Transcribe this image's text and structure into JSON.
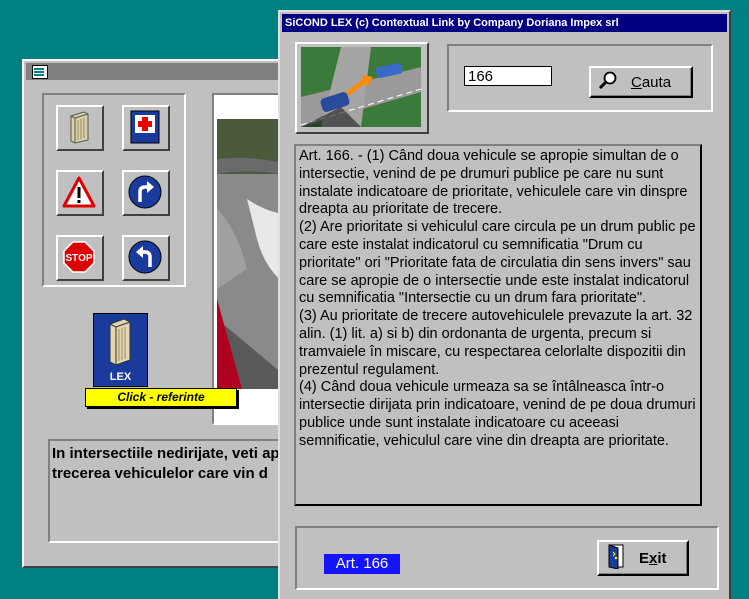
{
  "front_window": {
    "title": "SiCOND LEX (c) Contextual Link by Company Doriana Impex srl",
    "article_input_value": "166",
    "search_button_label": "Cauta",
    "article_text": "Art. 166. - (1) Când doua vehicule se apropie simultan de o intersectie, venind de pe drumuri publice pe care nu sunt instalate indicatoare de prioritate, vehiculele care vin dinspre dreapta au prioritate de trecere.\n(2) Are prioritate si vehiculul care circula pe un drum public pe care este instalat indicatorul cu semnificatia \"Drum cu prioritate\" ori \"Prioritate fata de circulatia din sens invers\" sau care se apropie de o intersectie unde este instalat indicatorul cu semnificatia \"Intersectie cu un drum fara prioritate\".\n(3) Au prioritate de trecere autovehiculele prevazute la art. 32 alin. (1) lit. a) si b) din ordonanta de urgenta, precum si tramvaiele în miscare, cu respectarea celorlalte dispozitii din prezentul regulament.\n(4) Când doua vehicule urmeaza sa se întâlneasca într-o intersectie dirijata prin indicatoare, venind de pe doua drumuri publice unde sunt instalate indicatoare cu aceeasi semnificatie, vehiculul care vine din dreapta are prioritate.",
    "article_badge": "Art. 166",
    "exit_button_label": "Exit"
  },
  "back_window": {
    "lex_badge_label": "LEX",
    "click_referinte_label": "Click - referinte",
    "description_line1": "In intersectiile nedirijate, veti ap",
    "description_line2": "trecerea vehiculelor care vin d"
  },
  "icons": [
    "book-icon",
    "first-aid-icon",
    "warning-triangle-icon",
    "turn-right-icon",
    "stop-sign-icon",
    "turn-left-icon",
    "search-icon",
    "exit-door-icon"
  ],
  "colors": {
    "desktop": "#008080",
    "title_active": "#000080",
    "title_inactive": "#808080",
    "article_badge": "#1414ff",
    "click_referinte_bg": "#ffff00"
  }
}
